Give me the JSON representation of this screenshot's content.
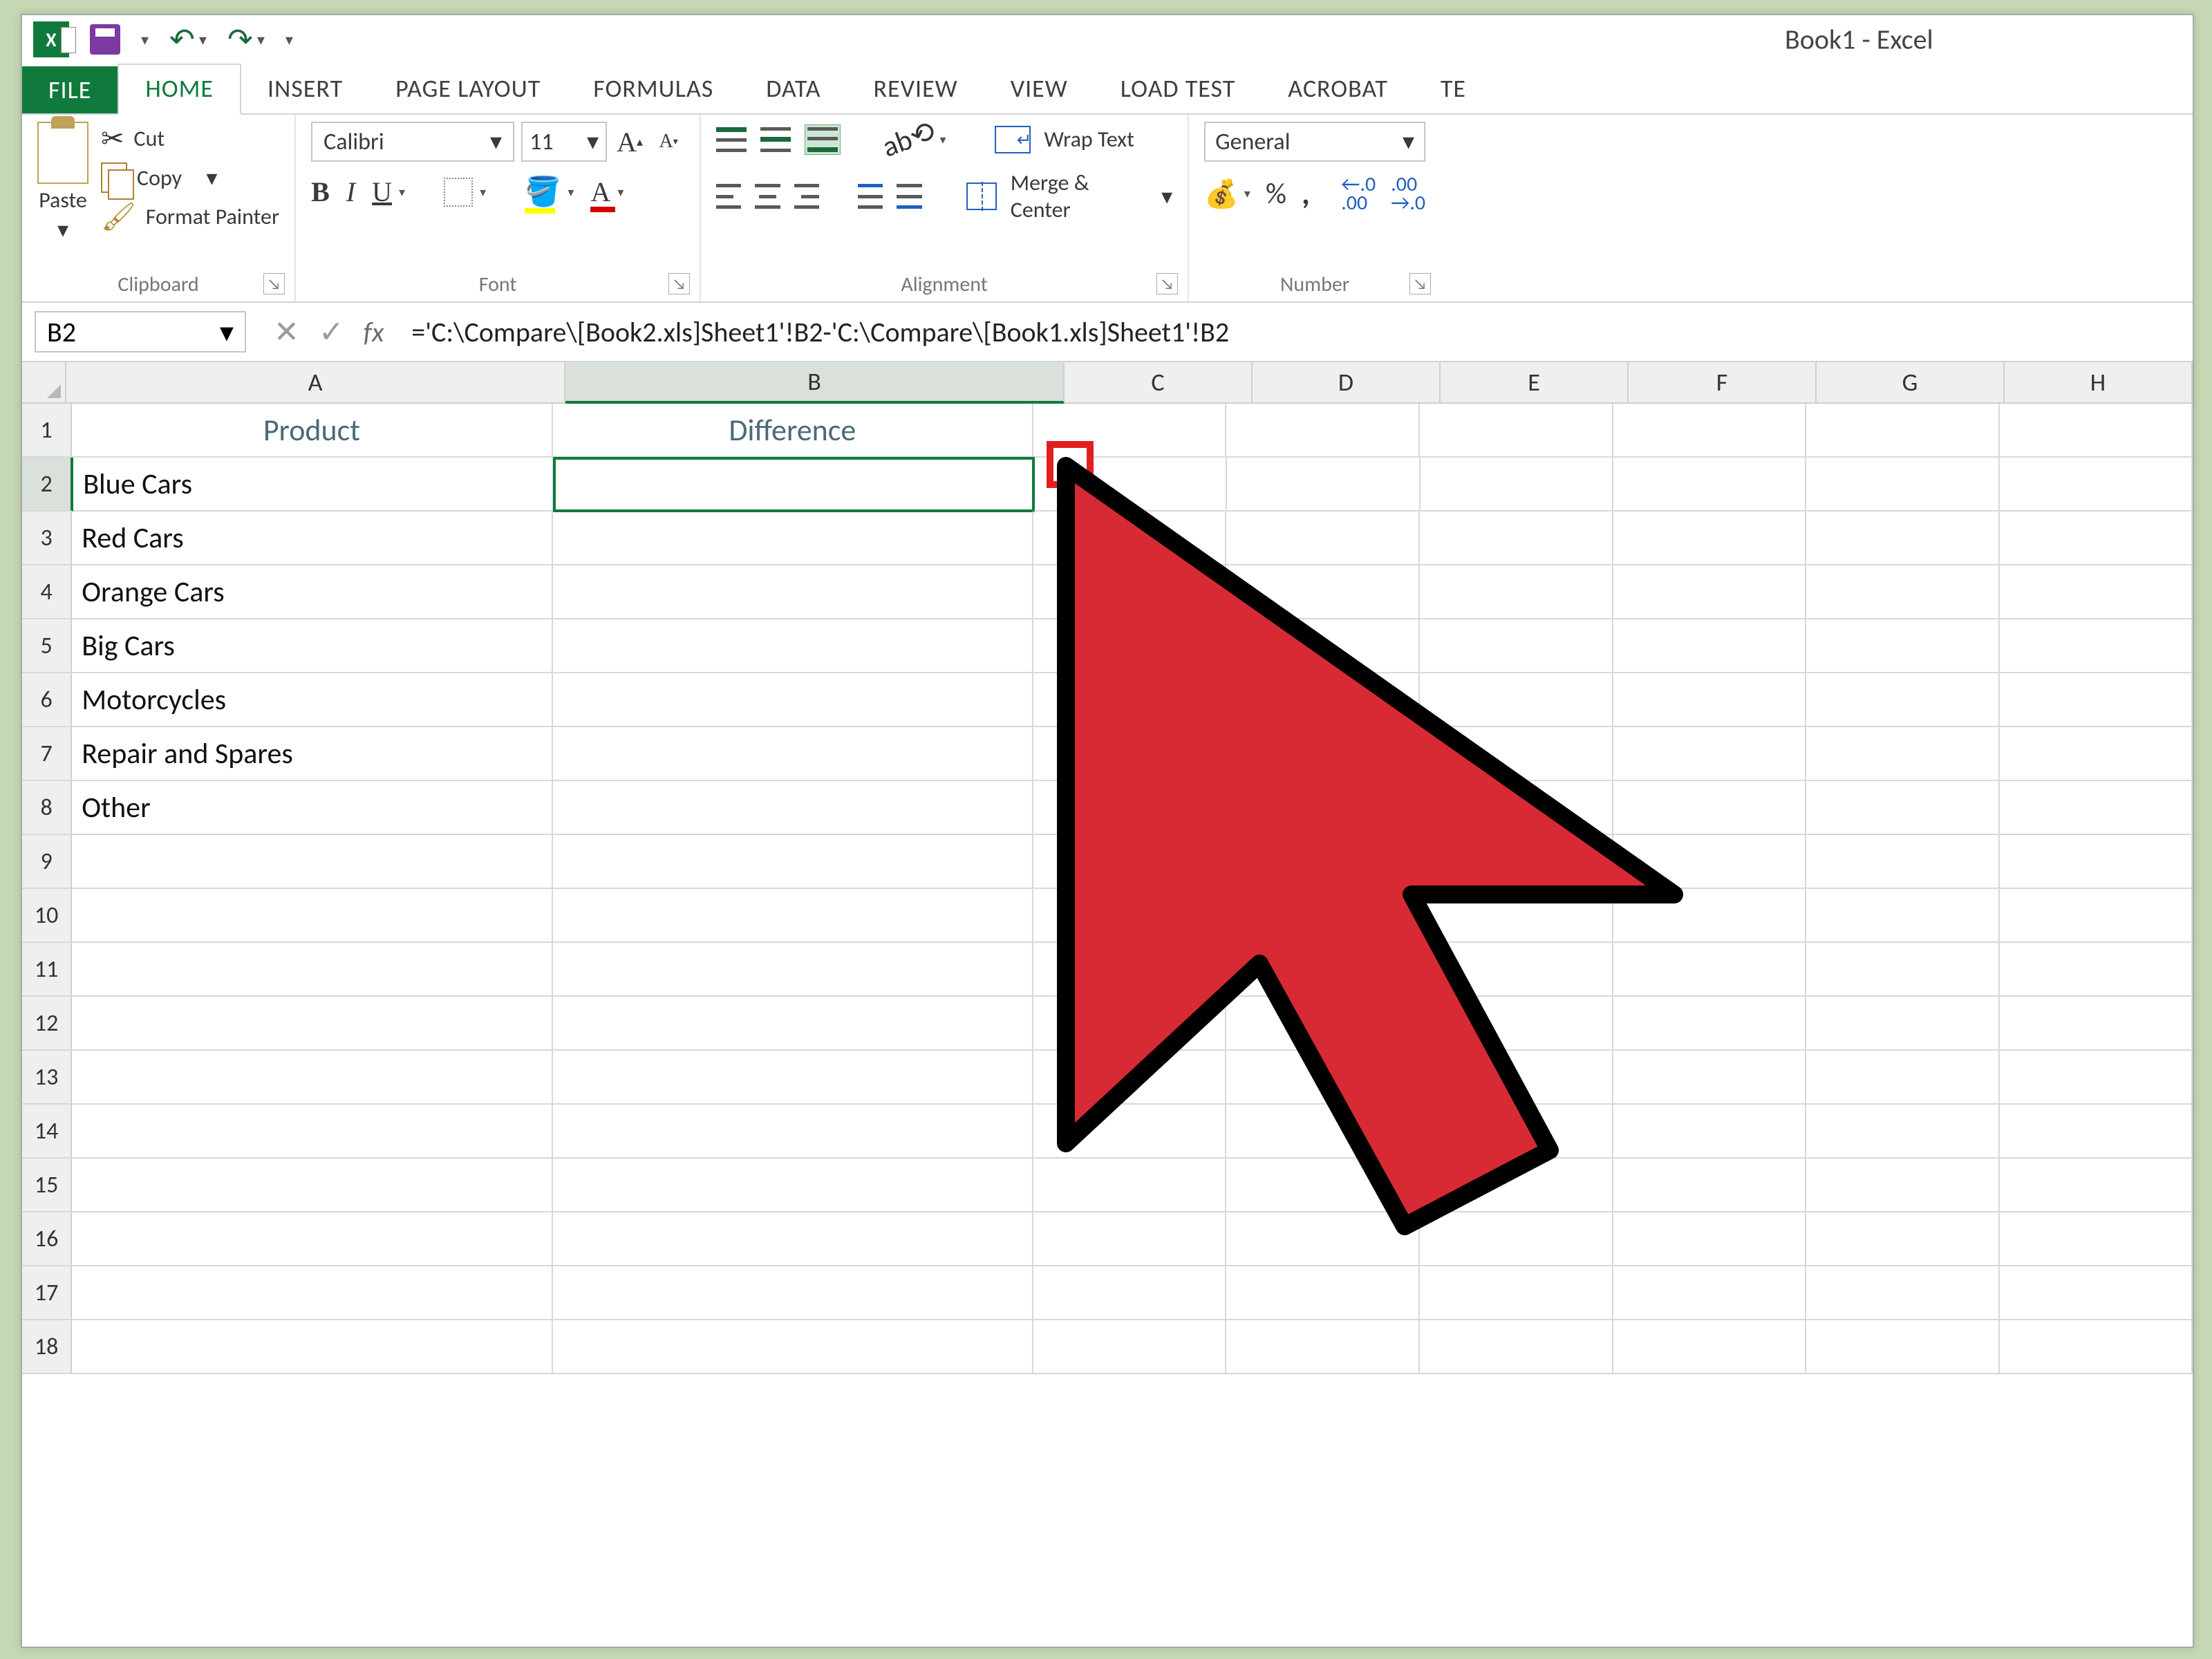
{
  "window": {
    "title": "Book1 - Excel"
  },
  "tabs": {
    "file": "FILE",
    "home": "HOME",
    "insert": "INSERT",
    "page_layout": "PAGE LAYOUT",
    "formulas": "FORMULAS",
    "data": "DATA",
    "review": "REVIEW",
    "view": "VIEW",
    "load_test": "LOAD TEST",
    "acrobat": "ACROBAT",
    "te": "TE"
  },
  "ribbon": {
    "clipboard": {
      "label": "Clipboard",
      "paste": "Paste",
      "cut": "Cut",
      "copy": "Copy",
      "format_painter": "Format Painter"
    },
    "font": {
      "label": "Font",
      "name": "Calibri",
      "size": "11",
      "bold": "B",
      "italic": "I",
      "underline": "U",
      "fontcolor_letter": "A",
      "grow": "A",
      "shrink": "A"
    },
    "alignment": {
      "label": "Alignment",
      "wrap": "Wrap Text",
      "merge": "Merge & Center"
    },
    "number": {
      "label": "Number",
      "format": "General",
      "pct": "%",
      "comma": ",",
      "dec_inc": ".0\n.00",
      "dec_dec": ".00\n.0"
    }
  },
  "formula_bar": {
    "cell_ref": "B2",
    "formula": "='C:\\Compare\\[Book2.xls]Sheet1'!B2-'C:\\Compare\\[Book1.xls]Sheet1'!B2"
  },
  "columns": [
    "A",
    "B",
    "C",
    "D",
    "E",
    "F",
    "G",
    "H"
  ],
  "row_count": 18,
  "headers": {
    "A": "Product",
    "B": "Difference"
  },
  "data_rows": [
    "Blue Cars",
    "Red Cars",
    "Orange Cars",
    "Big Cars",
    "Motorcycles",
    "Repair and Spares",
    "Other"
  ],
  "active_cell": {
    "col": "B",
    "row": 2
  },
  "annotation": {
    "fill_handle_highlight": true
  }
}
